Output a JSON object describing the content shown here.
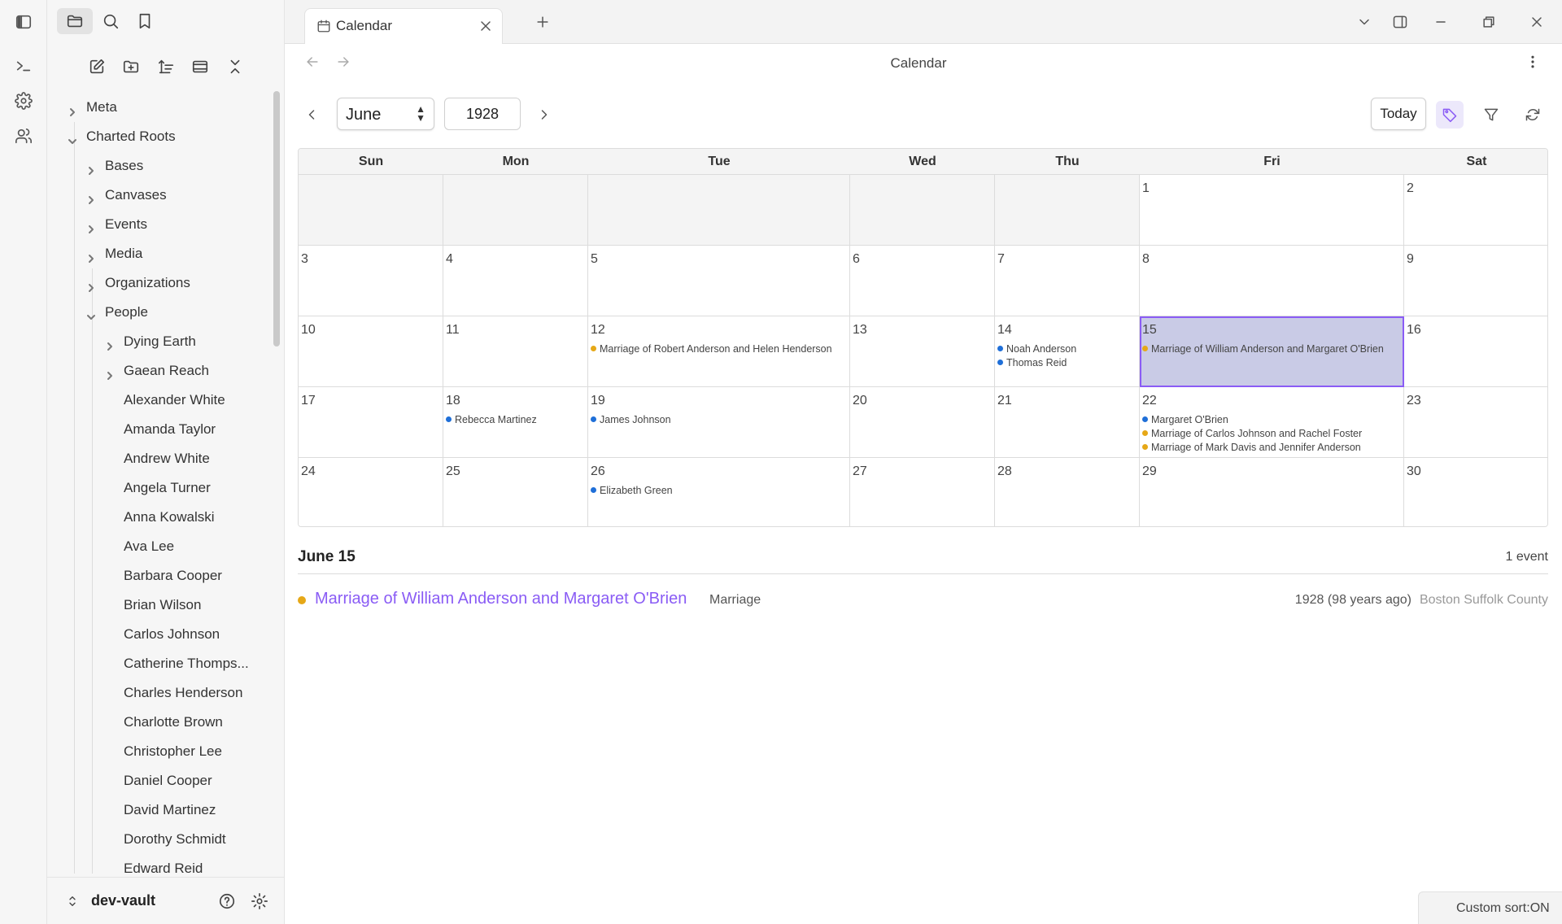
{
  "ribbon": {
    "items": [
      {
        "icon": "terminal-icon"
      },
      {
        "icon": "gear-icon"
      },
      {
        "icon": "people-icon"
      }
    ]
  },
  "sidebar": {
    "tree": [
      {
        "label": "Meta",
        "level": 0,
        "type": "folder",
        "expanded": false
      },
      {
        "label": "Charted Roots",
        "level": 0,
        "type": "folder",
        "expanded": true
      },
      {
        "label": "Bases",
        "level": 1,
        "type": "folder",
        "expanded": false
      },
      {
        "label": "Canvases",
        "level": 1,
        "type": "folder",
        "expanded": false
      },
      {
        "label": "Events",
        "level": 1,
        "type": "folder",
        "expanded": false
      },
      {
        "label": "Media",
        "level": 1,
        "type": "folder",
        "expanded": false
      },
      {
        "label": "Organizations",
        "level": 1,
        "type": "folder",
        "expanded": false
      },
      {
        "label": "People",
        "level": 1,
        "type": "folder",
        "expanded": true
      },
      {
        "label": "Dying Earth",
        "level": 2,
        "type": "folder",
        "expanded": false
      },
      {
        "label": "Gaean Reach",
        "level": 2,
        "type": "folder",
        "expanded": false
      },
      {
        "label": "Alexander White",
        "level": 2,
        "type": "file"
      },
      {
        "label": "Amanda Taylor",
        "level": 2,
        "type": "file"
      },
      {
        "label": "Andrew White",
        "level": 2,
        "type": "file"
      },
      {
        "label": "Angela Turner",
        "level": 2,
        "type": "file"
      },
      {
        "label": "Anna Kowalski",
        "level": 2,
        "type": "file"
      },
      {
        "label": "Ava Lee",
        "level": 2,
        "type": "file"
      },
      {
        "label": "Barbara Cooper",
        "level": 2,
        "type": "file"
      },
      {
        "label": "Brian Wilson",
        "level": 2,
        "type": "file"
      },
      {
        "label": "Carlos Johnson",
        "level": 2,
        "type": "file"
      },
      {
        "label": "Catherine Thomps...",
        "level": 2,
        "type": "file"
      },
      {
        "label": "Charles Henderson",
        "level": 2,
        "type": "file"
      },
      {
        "label": "Charlotte Brown",
        "level": 2,
        "type": "file"
      },
      {
        "label": "Christopher Lee",
        "level": 2,
        "type": "file"
      },
      {
        "label": "Daniel Cooper",
        "level": 2,
        "type": "file"
      },
      {
        "label": "David Martinez",
        "level": 2,
        "type": "file"
      },
      {
        "label": "Dorothy Schmidt",
        "level": 2,
        "type": "file"
      },
      {
        "label": "Edward Reid",
        "level": 2,
        "type": "file"
      }
    ],
    "vault_name": "dev-vault"
  },
  "tabs": [
    {
      "label": "Calendar",
      "active": true
    }
  ],
  "view": {
    "title": "Calendar"
  },
  "calendar": {
    "month": "June",
    "year": "1928",
    "today_label": "Today",
    "weekdays": [
      "Sun",
      "Mon",
      "Tue",
      "Wed",
      "Thu",
      "Fri",
      "Sat"
    ],
    "first_weekday_index": 5,
    "days_in_month": 30,
    "selected_day": 15,
    "events": {
      "12": [
        {
          "label": "Marriage of Robert Anderson and Helen Henderson",
          "kind": "marriage"
        }
      ],
      "14": [
        {
          "label": "Noah Anderson",
          "kind": "person"
        },
        {
          "label": "Thomas Reid",
          "kind": "person"
        }
      ],
      "15": [
        {
          "label": "Marriage of William Anderson and Margaret O'Brien",
          "kind": "marriage"
        }
      ],
      "18": [
        {
          "label": "Rebecca Martinez",
          "kind": "person"
        }
      ],
      "19": [
        {
          "label": "James Johnson",
          "kind": "person"
        }
      ],
      "22": [
        {
          "label": "Margaret O'Brien",
          "kind": "person"
        },
        {
          "label": "Marriage of Carlos Johnson and Rachel Foster",
          "kind": "marriage"
        },
        {
          "label": "Marriage of Mark Davis and Jennifer Anderson",
          "kind": "marriage"
        }
      ],
      "26": [
        {
          "label": "Elizabeth Green",
          "kind": "person"
        }
      ]
    },
    "colors": {
      "marriage": "#e6a817",
      "person": "#1f6fd8",
      "accent": "#8a5cf5",
      "selected_bg": "#c9cbe6"
    }
  },
  "detail": {
    "date_title": "June 15",
    "count_label": "1 event",
    "events": [
      {
        "title": "Marriage of William Anderson and Margaret O'Brien",
        "type": "Marriage",
        "date": "1928 (98 years ago)",
        "place": "Boston Suffolk County",
        "color": "#e6a817"
      }
    ]
  },
  "status": {
    "text": "Custom sort:ON"
  }
}
